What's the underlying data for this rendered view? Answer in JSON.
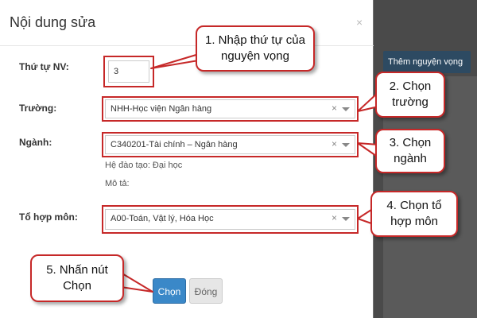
{
  "modal": {
    "title": "Nội dung sửa",
    "close_icon": "close-icon"
  },
  "background": {
    "button_label": "Thêm nguyện vọng"
  },
  "form": {
    "order_label": "Thứ tự NV:",
    "order_value": "3",
    "school_label": "Trường:",
    "school_value": "NHH-Học viện Ngân hàng",
    "major_label": "Ngành:",
    "major_value": "C340201-Tài chính – Ngân hàng",
    "training_system": "Hệ đào tạo: Đại học",
    "description": "Mô tả:",
    "combo_label": "Tổ hợp môn:",
    "combo_value": "A00-Toán, Vật lý, Hóa Học",
    "clear_symbol": "×"
  },
  "buttons": {
    "choose": "Chọn",
    "close": "Đóng"
  },
  "callouts": {
    "step1": "1. Nhập thứ tự của nguyện vọng",
    "step2": "2. Chọn trường",
    "step3": "3. Chọn ngành",
    "step4": "4. Chọn tổ hợp môn",
    "step5": "5. Nhấn nút Chọn"
  },
  "colors": {
    "annotation_red": "#c62828",
    "primary_button": "#3a88c8",
    "background_button": "#2d4a62"
  }
}
